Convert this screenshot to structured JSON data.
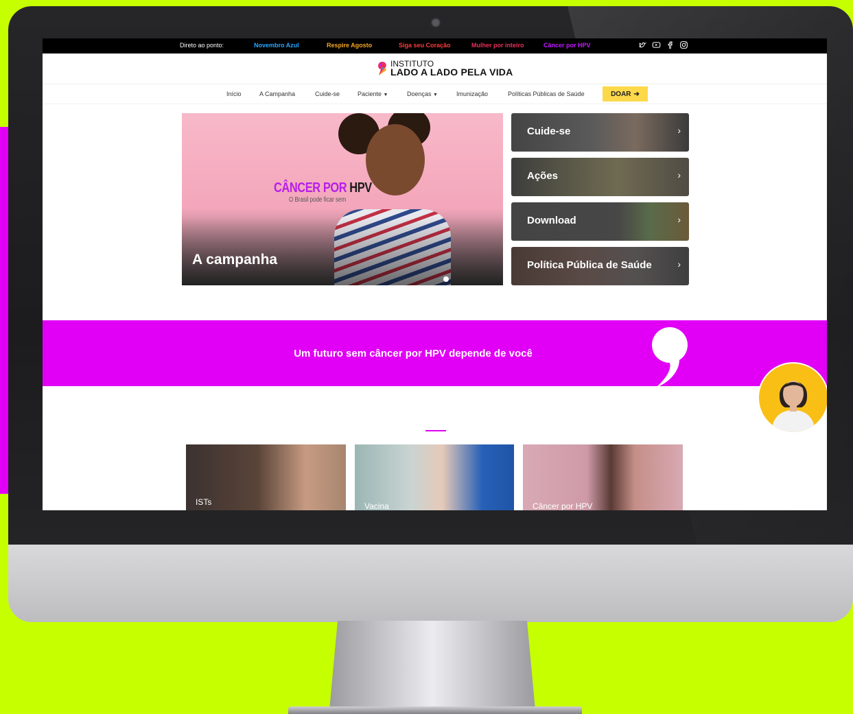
{
  "topbar": {
    "direct_label": "Direto ao ponto:",
    "links": [
      {
        "label": "Novembro Azul",
        "color": "#2aa7ff"
      },
      {
        "label": "Respire Agosto",
        "color": "#f5a623"
      },
      {
        "label": "Siga seu Coração",
        "color": "#ff3b3b"
      },
      {
        "label": "Mulher por inteiro",
        "color": "#e8305a"
      },
      {
        "label": "Câncer por HPV",
        "color": "#c21bff"
      }
    ],
    "social_icons": [
      "twitter-icon",
      "youtube-icon",
      "facebook-icon",
      "instagram-icon"
    ]
  },
  "logo": {
    "line1": "INSTITUTO",
    "line2": "LADO A LADO PELA VIDA"
  },
  "nav": {
    "items": [
      "Início",
      "A Campanha",
      "Cuide-se",
      "Paciente",
      "Doenças",
      "Imunização",
      "Políticas Públicas de Saúde"
    ],
    "donate_label": "DOAR"
  },
  "hero": {
    "campaign_title_a": "CÂNCER POR",
    "campaign_title_b": "HPV",
    "campaign_subtitle": "O Brasil pode ficar sem",
    "label": "A campanha"
  },
  "cards": [
    "Cuide-se",
    "Ações",
    "Download",
    "Política Pública de Saúde"
  ],
  "quote": {
    "text": "Um futuro sem câncer por HPV depende de você"
  },
  "bottom_cards": [
    "ISTs",
    "Vacina",
    "Câncer por HPV"
  ],
  "colors": {
    "accent": "#e100f5",
    "background": "#c6ff00",
    "donate": "#fcd94a"
  }
}
